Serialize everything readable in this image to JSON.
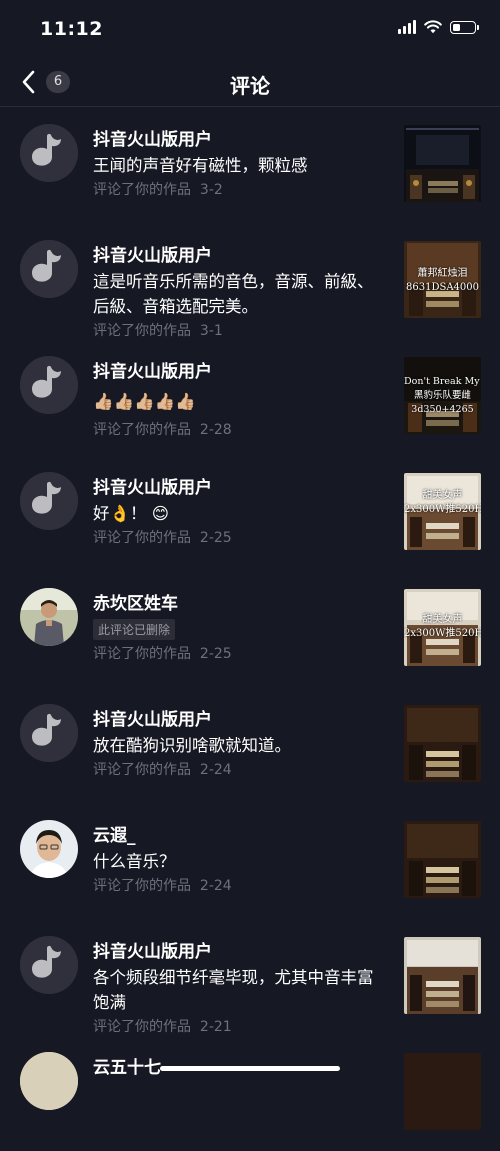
{
  "status": {
    "time": "11:12",
    "battery_level": 0.35
  },
  "nav": {
    "back_count": "6",
    "title": "评论"
  },
  "comments": [
    {
      "username": "抖音火山版用户",
      "text": "王闻的声音好有磁性，颗粒感",
      "action": "评论了你的作品",
      "date": "3-2",
      "thumb": {
        "lines": []
      }
    },
    {
      "username": "抖音火山版用户",
      "text": "這是听音乐所需的音色，音源、前級、后級、音箱选配完美。",
      "action": "评论了你的作品",
      "date": "3-1",
      "thumb": {
        "lines": [
          "蕭邦紅烛泪",
          "8631DSA4000"
        ]
      }
    },
    {
      "username": "抖音火山版用户",
      "text": "👍🏼👍🏼👍🏼👍🏼👍🏼",
      "action": "评论了你的作品",
      "date": "2-28",
      "thumb": {
        "lines": [
          "Don't Break My Heart",
          "黑豹乐队要雌",
          "3d350+4265"
        ]
      }
    },
    {
      "username": "抖音火山版用户",
      "text": "好👌！ 😊",
      "action": "评论了你的作品",
      "date": "2-25",
      "thumb": {
        "lines": [
          "甜美女声",
          "2x300W推520H"
        ]
      }
    },
    {
      "username": "赤坎区姓车",
      "deleted_badge": "此评论已删除",
      "action": "评论了你的作品",
      "date": "2-25",
      "thumb": {
        "lines": [
          "甜美女声",
          "2x300W推520H"
        ]
      }
    },
    {
      "username": "抖音火山版用户",
      "text": "放在酷狗识别啥歌就知道。",
      "action": "评论了你的作品",
      "date": "2-24",
      "thumb": {
        "lines": []
      }
    },
    {
      "username": "云遐_",
      "text": "什么音乐？",
      "action": "评论了你的作品",
      "date": "2-24",
      "thumb": {
        "lines": []
      }
    },
    {
      "username": "抖音火山版用户",
      "text": "各个频段细节纤毫毕现，尤其中音丰富饱满",
      "action": "评论了你的作品",
      "date": "2-21",
      "thumb": {
        "lines": []
      }
    },
    {
      "username": "云五十七",
      "text": "",
      "action": "",
      "date": "",
      "thumb": {
        "lines": []
      }
    }
  ]
}
